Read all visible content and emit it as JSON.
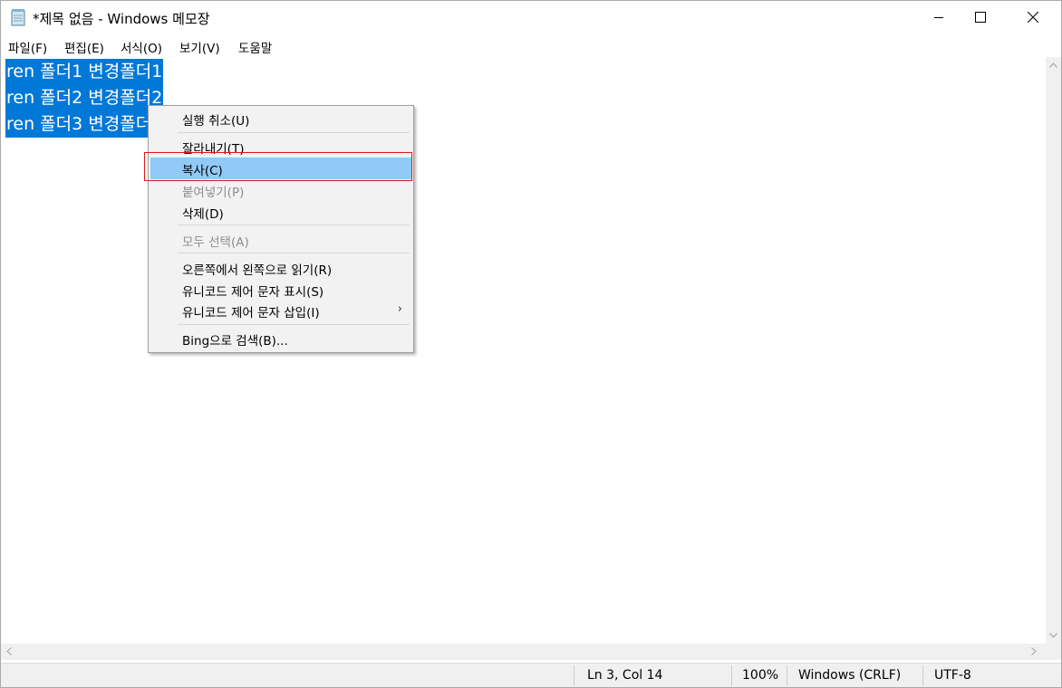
{
  "window": {
    "title": "*제목 없음 - Windows 메모장",
    "icon": "notepad-icon",
    "controls": [
      "minimize-icon",
      "maximize-icon",
      "close-icon"
    ]
  },
  "menubar": {
    "items": [
      "파일(F)",
      "편집(E)",
      "서식(O)",
      "보기(V)",
      "도움말"
    ]
  },
  "editor": {
    "lines": [
      "ren 폴더1 변경폴더1",
      "ren 폴더2 변경폴더2",
      "ren 폴더3 변경폴더3"
    ],
    "selection_color": "#0078d7"
  },
  "context_menu": {
    "items": [
      {
        "label": "실행 취소(U)",
        "enabled": true
      },
      {
        "label": "잘라내기(T)",
        "enabled": true
      },
      {
        "label": "복사(C)",
        "enabled": true,
        "highlighted": true
      },
      {
        "label": "붙여넣기(P)",
        "enabled": false
      },
      {
        "label": "삭제(D)",
        "enabled": true
      },
      {
        "label": "모두 선택(A)",
        "enabled": false
      },
      {
        "label": "오른쪽에서 왼쪽으로 읽기(R)",
        "enabled": true
      },
      {
        "label": "유니코드 제어 문자 표시(S)",
        "enabled": true
      },
      {
        "label": "유니코드 제어 문자 삽입(I)",
        "enabled": true,
        "submenu": true
      },
      {
        "label": "Bing으로 검색(B)...",
        "enabled": true
      }
    ],
    "submenu_arrow": "›",
    "hover_color": "#91c9f7",
    "annotation_color": "#e0191b"
  },
  "statusbar": {
    "position": "Ln 3, Col 14",
    "zoom": "100%",
    "line_ending": "Windows (CRLF)",
    "encoding": "UTF-8"
  }
}
